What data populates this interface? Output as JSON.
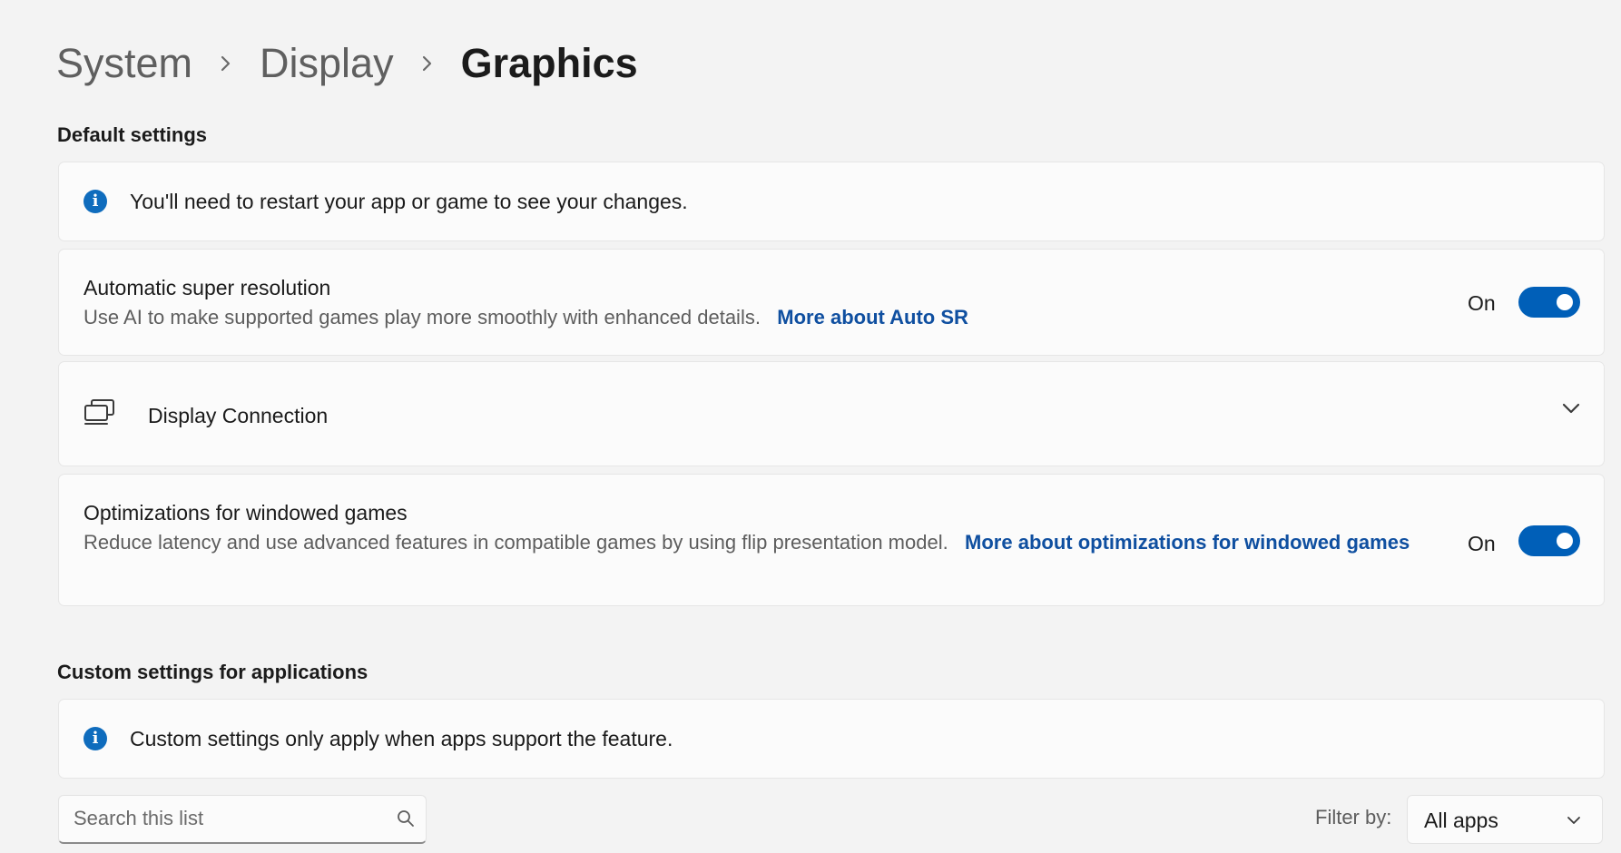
{
  "breadcrumb": {
    "items": [
      "System",
      "Display"
    ],
    "current": "Graphics"
  },
  "default_settings": {
    "heading": "Default settings",
    "info_text": "You'll need to restart your app or game to see your changes.",
    "auto_sr": {
      "title": "Automatic super resolution",
      "description": "Use AI to make supported games play more smoothly with enhanced details.",
      "link": "More about Auto SR",
      "state_label": "On",
      "enabled": true
    },
    "display_connection": {
      "title": "Display Connection",
      "icon": "display-connection-icon"
    },
    "windowed_games": {
      "title": "Optimizations for windowed games",
      "description": "Reduce latency and use advanced features in compatible games by using flip presentation model.",
      "link": "More about optimizations for windowed games",
      "state_label": "On",
      "enabled": true
    }
  },
  "custom_settings": {
    "heading": "Custom settings for applications",
    "info_text": "Custom settings only apply when apps support the feature.",
    "search": {
      "placeholder": "Search this list",
      "value": ""
    },
    "filter": {
      "label": "Filter by:",
      "selected": "All apps"
    }
  },
  "colors": {
    "accent": "#005fb8",
    "link": "#0f4fa0",
    "info": "#0f6cbd",
    "background": "#f3f3f3",
    "card": "#fbfbfb"
  }
}
